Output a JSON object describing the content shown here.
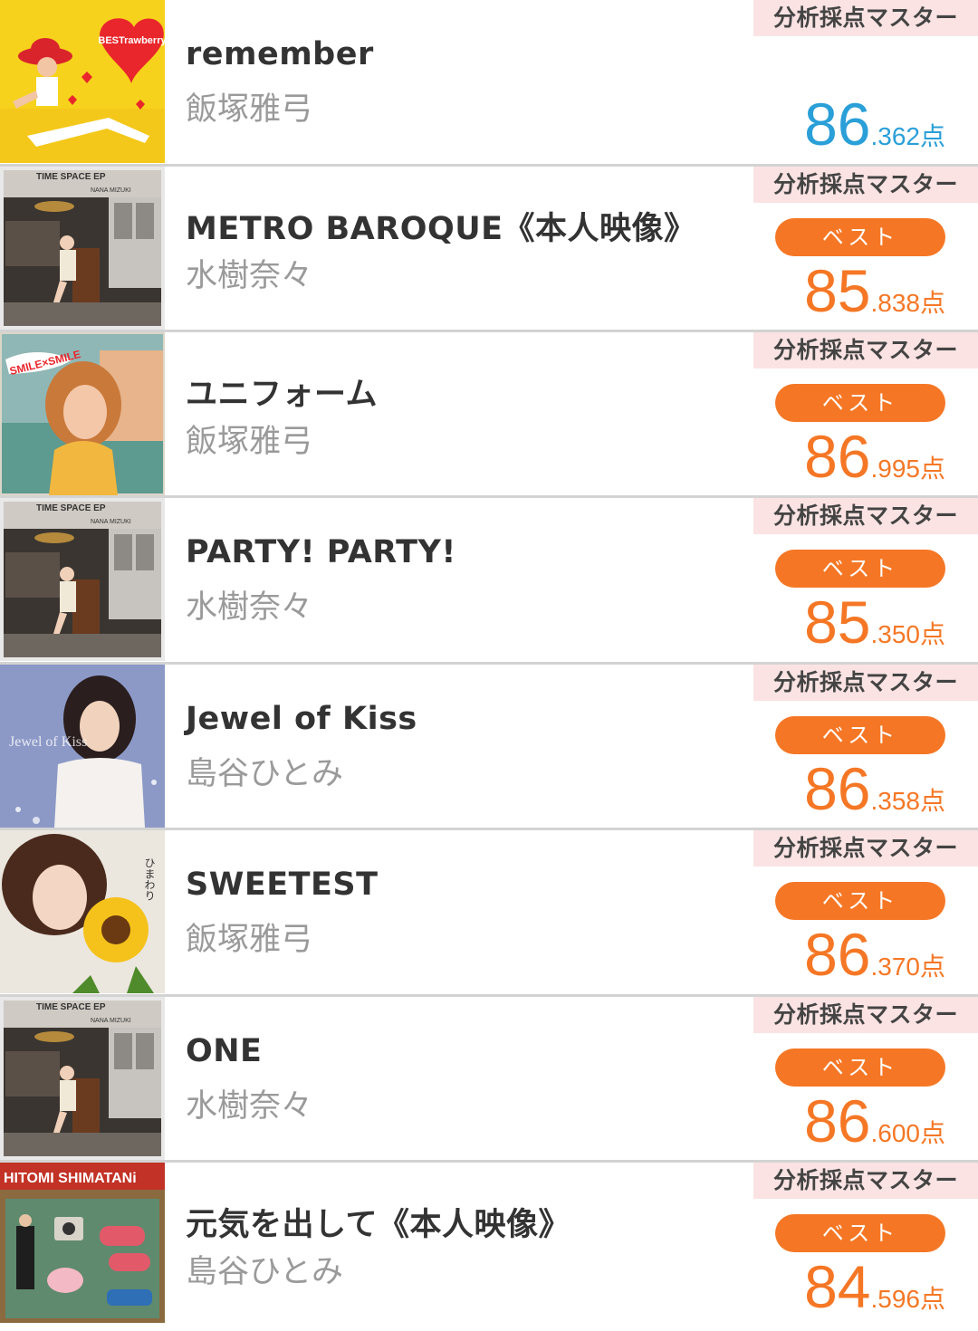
{
  "colors": {
    "accent": "#f57725",
    "score_blue": "#2a9fd8",
    "badge_bg": "#fbe3e3",
    "artist_gray": "#9a9a9a",
    "title_dark": "#333333"
  },
  "songs": [
    {
      "title": "remember",
      "artist": "飯塚雅弓",
      "mode": "分析採点マスター",
      "best": "",
      "score_int": "86",
      "score_dec": ".362",
      "score_unit": "点",
      "score_color": "blue",
      "jacket": "jacket-bestrawberry"
    },
    {
      "title": "METRO BAROQUE《本人映像》",
      "artist": "水樹奈々",
      "mode": "分析採点マスター",
      "best": "ベスト",
      "score_int": "85",
      "score_dec": ".838",
      "score_unit": "点",
      "score_color": "orange",
      "jacket": "jacket-time-space-ep"
    },
    {
      "title": "ユニフォーム",
      "artist": "飯塚雅弓",
      "mode": "分析採点マスター",
      "best": "ベスト",
      "score_int": "86",
      "score_dec": ".995",
      "score_unit": "点",
      "score_color": "orange",
      "jacket": "jacket-smile-x-smile"
    },
    {
      "title": "PARTY! PARTY!",
      "artist": "水樹奈々",
      "mode": "分析採点マスター",
      "best": "ベスト",
      "score_int": "85",
      "score_dec": ".350",
      "score_unit": "点",
      "score_color": "orange",
      "jacket": "jacket-time-space-ep"
    },
    {
      "title": "Jewel of Kiss",
      "artist": "島谷ひとみ",
      "mode": "分析採点マスター",
      "best": "ベスト",
      "score_int": "86",
      "score_dec": ".358",
      "score_unit": "点",
      "score_color": "orange",
      "jacket": "jacket-jewel-of-kiss"
    },
    {
      "title": "SWEETEST",
      "artist": "飯塚雅弓",
      "mode": "分析採点マスター",
      "best": "ベスト",
      "score_int": "86",
      "score_dec": ".370",
      "score_unit": "点",
      "score_color": "orange",
      "jacket": "jacket-himawari"
    },
    {
      "title": "ONE",
      "artist": "水樹奈々",
      "mode": "分析採点マスター",
      "best": "ベスト",
      "score_int": "86",
      "score_dec": ".600",
      "score_unit": "点",
      "score_color": "orange",
      "jacket": "jacket-time-space-ep"
    },
    {
      "title": "元気を出して《本人映像》",
      "artist": "島谷ひとみ",
      "mode": "分析採点マスター",
      "best": "ベスト",
      "score_int": "84",
      "score_dec": ".596",
      "score_unit": "点",
      "score_color": "orange",
      "jacket": "jacket-hitomi-shimatani"
    }
  ],
  "jacket_text": {
    "bestrawberry": "BESTrawberry",
    "time_space_ep": "TIME SPACE EP",
    "nana_mizuki": "NANA MIZUKI",
    "smile_x_smile": "SMILE×SMILE",
    "jewel_of_kiss": "Jewel of Kiss",
    "himawari": "ひまわり",
    "hitomi_shimatani": "HITOMI SHIMATANi"
  }
}
